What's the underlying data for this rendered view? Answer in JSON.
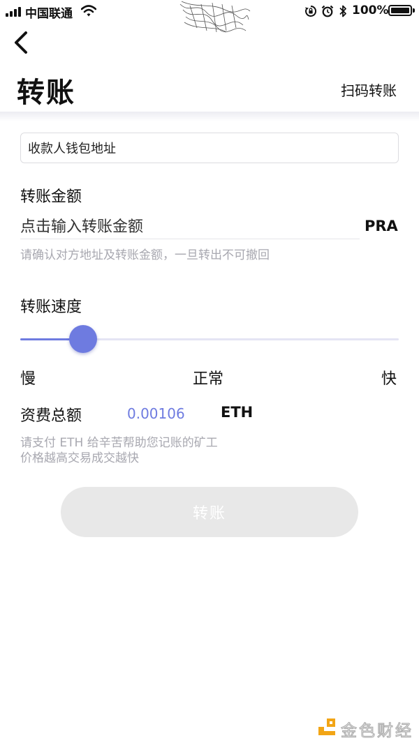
{
  "status_bar": {
    "carrier": "中国联通",
    "battery_percent": "100%",
    "battery_level": 1.0,
    "icons": [
      "signal-icon",
      "wifi-icon",
      "orientation-lock-icon",
      "alarm-icon",
      "bluetooth-icon",
      "battery-icon"
    ]
  },
  "header": {
    "back_icon": "chevron-left-icon",
    "title": "转账",
    "scan_label": "扫码转账"
  },
  "form": {
    "address_placeholder": "收款人钱包地址",
    "amount_label": "转账金额",
    "amount_placeholder": "点击输入转账金额",
    "amount_unit": "PRA",
    "amount_hint": "请确认对方地址及转账金额，一旦转出不可撤回",
    "speed_label": "转账速度",
    "speed_level": 0.12,
    "speed_slow": "慢",
    "speed_normal": "正常",
    "speed_fast": "快",
    "fee_label": "资费总额",
    "fee_value": "0.00106",
    "fee_unit": "ETH",
    "fee_hint_1": "请支付 ETH 给辛苦帮助您记账的矿工",
    "fee_hint_2": "价格越高交易成交越快",
    "submit_label": "转账"
  },
  "watermark": {
    "text": "金色财经"
  },
  "colors": {
    "accent": "#6e7be0",
    "hint_text": "#a8a8b0",
    "button_disabled_bg": "#e8e8e8"
  }
}
